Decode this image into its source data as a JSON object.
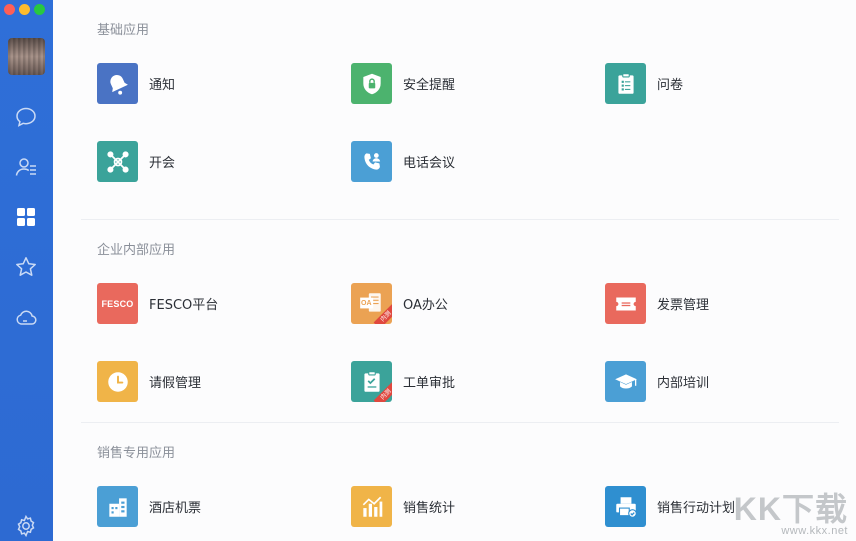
{
  "sidebar": {
    "nav": [
      {
        "icon": "chat-bubble-icon"
      },
      {
        "icon": "contacts-icon"
      },
      {
        "icon": "apps-grid-icon",
        "active": true
      },
      {
        "icon": "star-icon"
      },
      {
        "icon": "cloud-icon"
      },
      {
        "icon": "settings-gear-icon"
      }
    ]
  },
  "sections": [
    {
      "title": "基础应用",
      "apps": [
        {
          "label": "通知",
          "icon": "bell-icon",
          "color": "#4a73c4"
        },
        {
          "label": "安全提醒",
          "icon": "shield-lock-icon",
          "color": "#4cb36e"
        },
        {
          "label": "问卷",
          "icon": "clipboard-icon",
          "color": "#3ba39a"
        },
        {
          "label": "开会",
          "icon": "meeting-network-icon",
          "color": "#3ba39a"
        },
        {
          "label": "电话会议",
          "icon": "phone-conference-icon",
          "color": "#4b9fd5"
        }
      ]
    },
    {
      "title": "企业内部应用",
      "apps": [
        {
          "label": "FESCO平台",
          "icon": "fesco-logo-icon",
          "icon_text": "FESCO",
          "color": "#e9695d"
        },
        {
          "label": "OA办公",
          "icon": "oa-document-icon",
          "icon_text": "OA",
          "badge": "内测",
          "color": "#eba253"
        },
        {
          "label": "发票管理",
          "icon": "ticket-icon",
          "color": "#e9695d"
        },
        {
          "label": "请假管理",
          "icon": "clock-icon",
          "color": "#f0b448"
        },
        {
          "label": "工单审批",
          "icon": "checklist-icon",
          "badge": "内测",
          "color": "#3ba39a"
        },
        {
          "label": "内部培训",
          "icon": "graduation-cap-icon",
          "color": "#4b9fd5"
        }
      ]
    },
    {
      "title": "销售专用应用",
      "apps": [
        {
          "label": "酒店机票",
          "icon": "hotel-building-icon",
          "color": "#4b9fd5"
        },
        {
          "label": "销售统计",
          "icon": "bar-chart-icon",
          "color": "#f0b448"
        },
        {
          "label": "销售行动计划",
          "icon": "printer-check-icon",
          "color": "#2f8fd0"
        }
      ]
    }
  ],
  "watermark": {
    "main": "KK下载",
    "sub": "www.kkx.net"
  }
}
